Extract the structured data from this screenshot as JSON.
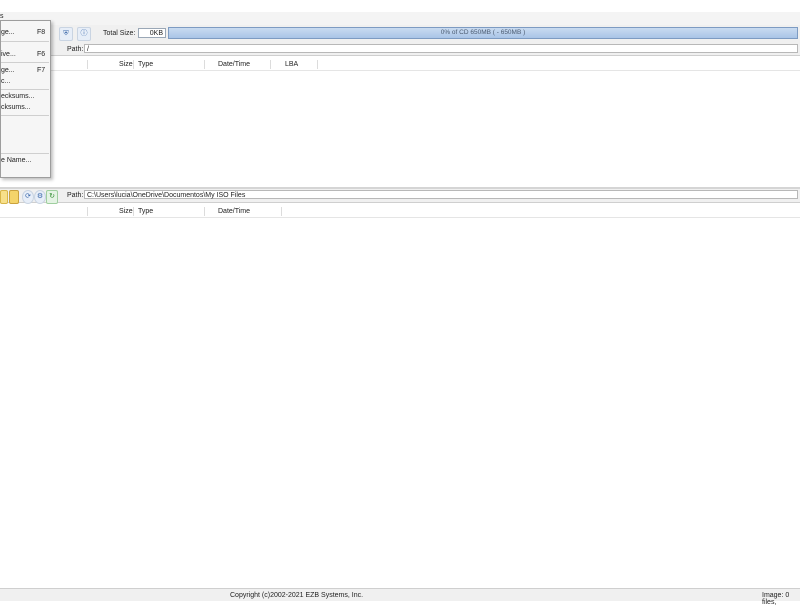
{
  "menubar": {
    "partial_label": "s"
  },
  "menu": {
    "items": [
      {
        "label": "ge...",
        "shortcut": "F8"
      },
      {
        "label": "ive...",
        "shortcut": "F6"
      },
      {
        "label": "ge...",
        "shortcut": "F7"
      },
      {
        "label": "c...",
        "shortcut": ""
      },
      {
        "label": "ecksums...",
        "shortcut": ""
      },
      {
        "label": "cksums...",
        "shortcut": ""
      },
      {
        "label": "e Name...",
        "shortcut": ""
      }
    ]
  },
  "toolbar": {
    "total_size_label": "Total Size:",
    "total_size_value": "0KB",
    "capacity_text": "0% of CD 650MB ( - 650MB )"
  },
  "image_panel": {
    "path_label": "Path:",
    "path_value": "/",
    "columns": [
      "Size",
      "Type",
      "Date/Time",
      "LBA"
    ]
  },
  "local_panel": {
    "path_label": "Path:",
    "path_value": "C:\\Users\\lucia\\OneDrive\\Documentos\\My ISO Files",
    "columns": [
      "Size",
      "Type",
      "Date/Time"
    ]
  },
  "status": {
    "copyright": "Copyright (c)2002-2021 EZB Systems, Inc.",
    "image_info": "Image: 0 files,"
  },
  "colors": {
    "progress_fill": "#a9c4e7",
    "toolbar_bg": "#f0f0f0",
    "menu_bg": "#f6f6f6"
  },
  "icons": [
    "shield-icon",
    "info-icon",
    "folder-icon",
    "refresh-icon",
    "settings-icon",
    "back-icon"
  ]
}
